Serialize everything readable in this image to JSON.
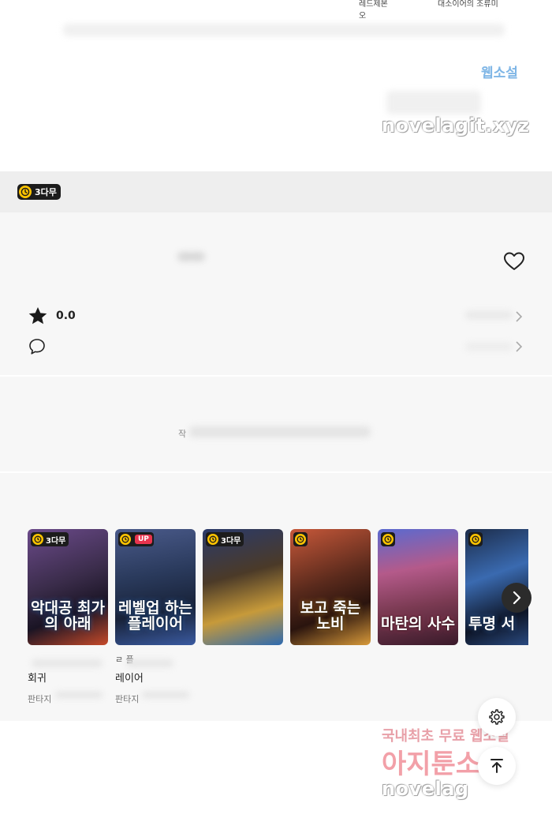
{
  "header": {
    "tabs": [
      "레드제본",
      "대소이어의 조류미오"
    ]
  },
  "watermark_top": {
    "site_mark": "웹소설",
    "domain": "novelagit.xyz"
  },
  "badge": {
    "label": "3다무"
  },
  "info": {
    "rating_value": "0.0"
  },
  "description": {
    "text": "작"
  },
  "recommendations": {
    "cards": [
      {
        "title_art": "악대공 최가의 아래",
        "badge": "3다무",
        "badge_type": "clock",
        "name": "회귀",
        "genre": "판타지",
        "name_top": ""
      },
      {
        "title_art": "레벨업 하는 플레이어",
        "badge": "UP",
        "badge_type": "up",
        "name": "레이어",
        "genre": "판타지",
        "name_top": "ㄹ 플"
      },
      {
        "title_art": "",
        "badge": "3다무",
        "badge_type": "clock",
        "name": "",
        "genre": "",
        "name_top": ""
      },
      {
        "title_art": "보고 죽는 노비",
        "badge": "",
        "badge_type": "clock-only",
        "name": "",
        "genre": "",
        "name_top": ""
      },
      {
        "title_art": "마탄의 사수",
        "badge": "",
        "badge_type": "clock-only",
        "name": "",
        "genre": "",
        "name_top": ""
      },
      {
        "title_art": "투명 서",
        "badge": "",
        "badge_type": "clock-only",
        "name": "",
        "genre": "",
        "name_top": ""
      }
    ],
    "cover_colors": [
      "#3a2c4a",
      "#2a3a5c",
      "#4b3a28",
      "#5a2a1c",
      "#7a3a52",
      "#1c2c4a"
    ]
  },
  "watermark_bottom": {
    "line1": "국내최초 무료 웹소설",
    "line2": "아지툰소설",
    "domain": "novelag"
  },
  "icons": {
    "badge_clock": "clock-icon",
    "favorite": "heart-icon",
    "rating": "star-icon",
    "comment": "speech-bubble-icon",
    "next": "chevron-right-icon",
    "settings": "gear-icon",
    "scroll_top": "arrow-up-to-line-icon"
  },
  "colors": {
    "badge_bg": "#1c1c1c",
    "clock_yellow": "#ffc400",
    "up_red": "#e8344e",
    "panel_bg": "#f7f7f7",
    "band_bg": "#eeeeee"
  }
}
